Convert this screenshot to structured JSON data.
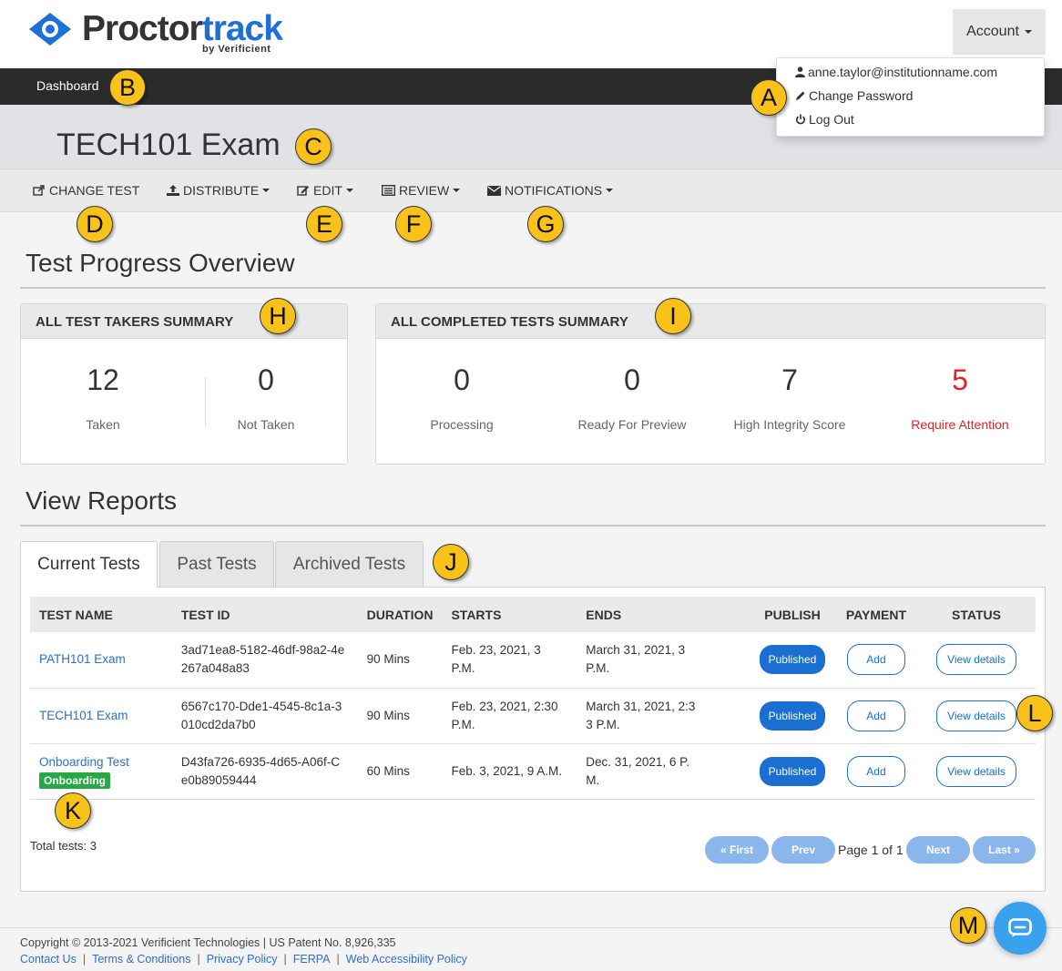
{
  "header": {
    "logo_main": "Proctor",
    "logo_accent": "track",
    "logo_sub": "by Verificient",
    "account_label": "Account",
    "account_menu": [
      {
        "label": "anne.taylor@institutionname.com",
        "icon": "user-icon"
      },
      {
        "label": "Change Password",
        "icon": "pencil-icon"
      },
      {
        "label": "Log Out",
        "icon": "power-icon"
      }
    ]
  },
  "nav": {
    "dashboard_label": "Dashboard"
  },
  "exam": {
    "title": "TECH101 Exam"
  },
  "toolbar": {
    "change_test": "CHANGE TEST",
    "distribute": "DISTRIBUTE",
    "edit": "EDIT",
    "review": "REVIEW",
    "notifications": "NOTIFICATIONS"
  },
  "overview": {
    "title": "Test Progress Overview",
    "takers_panel": {
      "title": "ALL TEST TAKERS SUMMARY",
      "stats": [
        {
          "value": "12",
          "label": "Taken"
        },
        {
          "value": "0",
          "label": "Not Taken"
        }
      ]
    },
    "completed_panel": {
      "title": "ALL COMPLETED TESTS SUMMARY",
      "stats": [
        {
          "value": "0",
          "label": "Processing"
        },
        {
          "value": "0",
          "label": "Ready For Preview"
        },
        {
          "value": "7",
          "label": "High Integrity Score"
        },
        {
          "value": "5",
          "label": "Require Attention"
        }
      ],
      "alert_color": "#e02424"
    }
  },
  "reports": {
    "title": "View Reports",
    "tabs": [
      "Current Tests",
      "Past Tests",
      "Archived Tests"
    ],
    "columns": [
      "TEST NAME",
      "TEST ID",
      "DURATION",
      "STARTS",
      "ENDS",
      "PUBLISH",
      "PAYMENT",
      "STATUS"
    ],
    "rows": [
      {
        "name": "PATH101 Exam",
        "badge": "",
        "id_l1": "3ad71ea8-5182-46df-98a2-4e",
        "id_l2": "267a048a83",
        "duration": "90 Mins",
        "starts_l1": "Feb. 23, 2021, 3 P.M.",
        "starts_l2": "",
        "ends_l1": "March 31, 2021, 3",
        "ends_l2": "P.M.",
        "publish": "Published",
        "payment": "Add",
        "status": "View details"
      },
      {
        "name": "TECH101 Exam",
        "badge": "",
        "id_l1": "6567c170-Dde1-4545-8c1a-3",
        "id_l2": "010cd2da7b0",
        "duration": "90 Mins",
        "starts_l1": "Feb. 23, 2021, 2:30",
        "starts_l2": "P.M.",
        "ends_l1": "March 31, 2021, 2:3",
        "ends_l2": "3 P.M.",
        "publish": "Published",
        "payment": "Add",
        "status": "View details"
      },
      {
        "name": "Onboarding Test",
        "badge": "Onboarding",
        "id_l1": "D43fa726-6935-4d65-A06f-C",
        "id_l2": "e0b89059444",
        "duration": "60 Mins",
        "starts_l1": "Feb. 3, 2021, 9 A.M.",
        "starts_l2": "",
        "ends_l1": "Dec. 31, 2021, 6 P.",
        "ends_l2": "M.",
        "publish": "Published",
        "payment": "Add",
        "status": "View details"
      }
    ],
    "total": "Total tests: 3",
    "pagination": {
      "first": "« First",
      "prev": "Prev",
      "page_text": "Page 1 of 1",
      "next": "Next",
      "last": "Last »"
    }
  },
  "footer": {
    "copyright": "Copyright © 2013-2021 Verificient Technologies | US Patent No. 8,926,335",
    "links": [
      "Contact Us",
      "Terms & Conditions",
      "Privacy Policy",
      "FERPA",
      "Web Accessibility Policy"
    ]
  },
  "callouts": [
    "A",
    "B",
    "C",
    "D",
    "E",
    "F",
    "G",
    "H",
    "I",
    "J",
    "K",
    "L",
    "M"
  ],
  "colors": {
    "brand_blue": "#1e6fd6",
    "navbar": "#2b2b2b",
    "callout": "#f9c21a",
    "badge_green": "#28a745",
    "chat": "#3aa2ec"
  }
}
